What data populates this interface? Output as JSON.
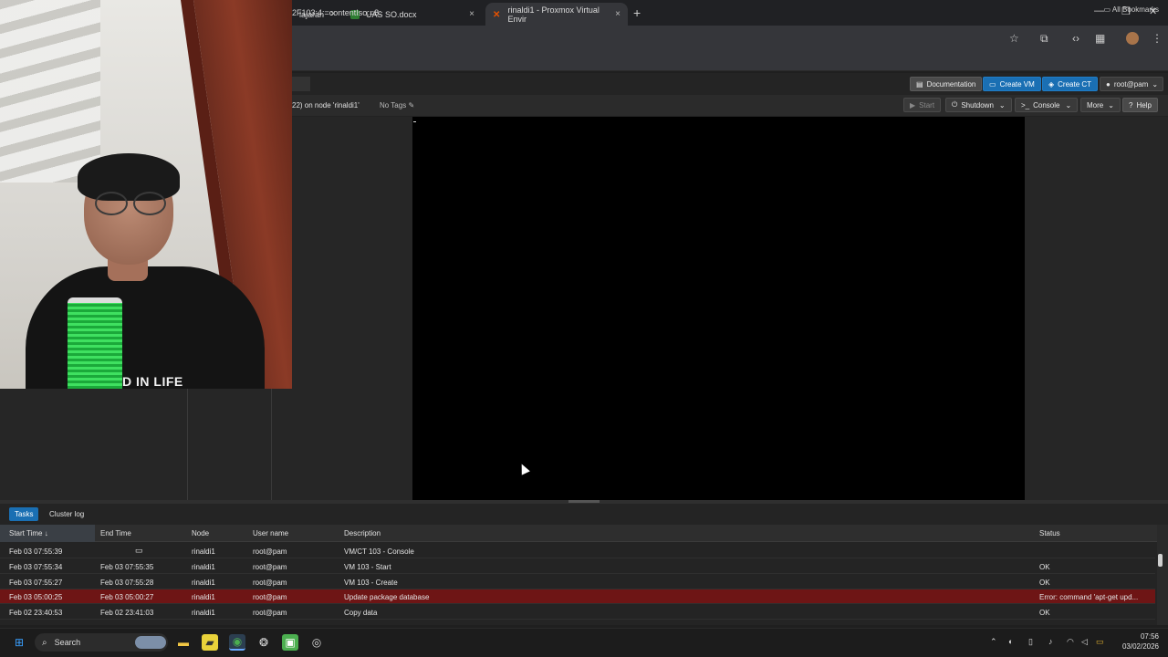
{
  "browser": {
    "tabs": [
      {
        "label": "lajaran",
        "close": "×"
      },
      {
        "label": "UAS SO.docx",
        "close": "×"
      },
      {
        "label": "rinaldi1 - Proxmox Virtual Envir",
        "close": "×"
      }
    ],
    "new_tab": "+",
    "url": "2F103:4:=contentIso:=8:",
    "bookmarks_label": "All Bookmarks",
    "window_controls": {
      "minimize": "—",
      "maximize": "❐",
      "close": "✕"
    }
  },
  "pve": {
    "header_buttons": {
      "documentation": "Documentation",
      "create_vm": "Create VM",
      "create_ct": "Create CT",
      "user": "root@pam"
    },
    "vm_title": "22) on node 'rinaldi1'",
    "no_tags": "No Tags",
    "toolbar": {
      "start": "Start",
      "shutdown": "Shutdown",
      "console": "Console",
      "more": "More",
      "help": "Help"
    }
  },
  "webcam": {
    "shirt_text": "D IN LIFE"
  },
  "tasks": {
    "tabs": [
      "Tasks",
      "Cluster log"
    ],
    "columns": [
      "Start Time",
      "End Time",
      "Node",
      "User name",
      "Description",
      "Status"
    ],
    "rows": [
      {
        "start": "Feb 03 07:55:39",
        "end": "",
        "node": "rinaldi1",
        "user": "root@pam",
        "desc": "VM/CT 103 - Console",
        "status": "",
        "error": false,
        "running": true
      },
      {
        "start": "Feb 03 07:55:34",
        "end": "Feb 03 07:55:35",
        "node": "rinaldi1",
        "user": "root@pam",
        "desc": "VM 103 - Start",
        "status": "OK",
        "error": false,
        "running": false
      },
      {
        "start": "Feb 03 07:55:27",
        "end": "Feb 03 07:55:28",
        "node": "rinaldi1",
        "user": "root@pam",
        "desc": "VM 103 - Create",
        "status": "OK",
        "error": false,
        "running": false
      },
      {
        "start": "Feb 03 05:00:25",
        "end": "Feb 03 05:00:27",
        "node": "rinaldi1",
        "user": "root@pam",
        "desc": "Update package database",
        "status": "Error: command 'apt-get upd...",
        "error": true,
        "running": false
      },
      {
        "start": "Feb 02 23:40:53",
        "end": "Feb 02 23:41:03",
        "node": "rinaldi1",
        "user": "root@pam",
        "desc": "Copy data",
        "status": "OK",
        "error": false,
        "running": false
      }
    ]
  },
  "taskbar": {
    "search_label": "Search",
    "time": "07:56",
    "date": "03/02/2026"
  },
  "colors": {
    "accent": "#1a6fb3",
    "error_row": "#6e1515"
  }
}
